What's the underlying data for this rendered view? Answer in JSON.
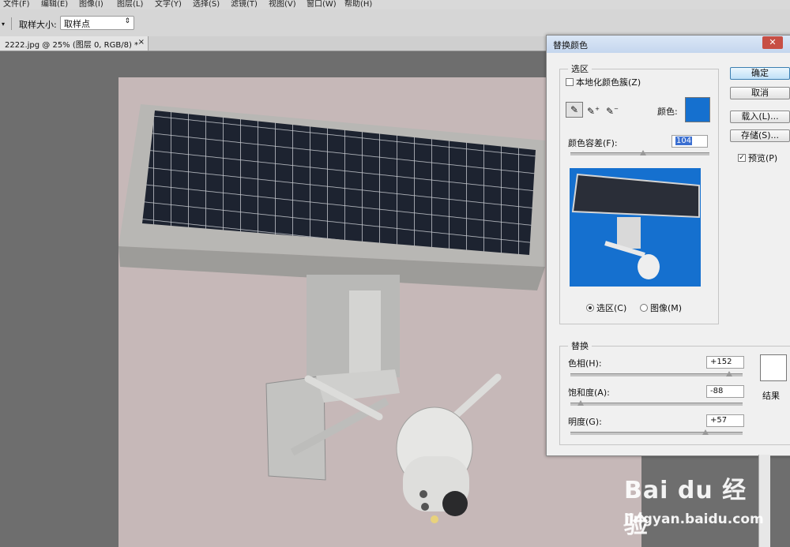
{
  "menu": [
    "文件(F)",
    "编辑(E)",
    "图像(I)",
    "图层(L)",
    "文字(Y)",
    "选择(S)",
    "滤镜(T)",
    "视图(V)",
    "窗口(W)",
    "帮助(H)"
  ],
  "options": {
    "sample_size_label": "取样大小:",
    "sample_size_value": "取样点"
  },
  "document": {
    "tab_title": "2222.jpg @ 25% (图层 0, RGB/8) *",
    "close": "×"
  },
  "dialog": {
    "title": "替换颜色",
    "close": "✕",
    "selection": {
      "group_label": "选区",
      "localized_label": "本地化颜色簇(Z)",
      "localized_checked": false,
      "color_label": "颜色:",
      "color_value": "#1570cf",
      "fuzziness_label": "颜色容差(F):",
      "fuzziness_value": "104",
      "fuzziness_fraction": 0.52,
      "mode_selection": "选区(C)",
      "mode_image": "图像(M)",
      "selected_mode": "selection"
    },
    "replacement": {
      "group_label": "替换",
      "hue_label": "色相(H):",
      "hue_value": "+152",
      "hue_fraction": 0.92,
      "saturation_label": "饱和度(A):",
      "saturation_value": "-88",
      "saturation_fraction": 0.06,
      "lightness_label": "明度(G):",
      "lightness_value": "+57",
      "lightness_fraction": 0.785,
      "result_label": "结果",
      "result_color": "#ffffff"
    },
    "buttons": {
      "ok": "确定",
      "cancel": "取消",
      "load": "载入(L)...",
      "save": "存储(S)...",
      "preview": "预览(P)",
      "preview_checked": true
    }
  },
  "watermark": {
    "brand": "Bai du 经验",
    "url": "jingyan.baidu.com"
  },
  "colors": {
    "canvas_bg": "#c6b8b8",
    "preview_bg": "#1570cf",
    "workspace": "#6e6e6e",
    "annotation_arrow": "#e8352c"
  }
}
